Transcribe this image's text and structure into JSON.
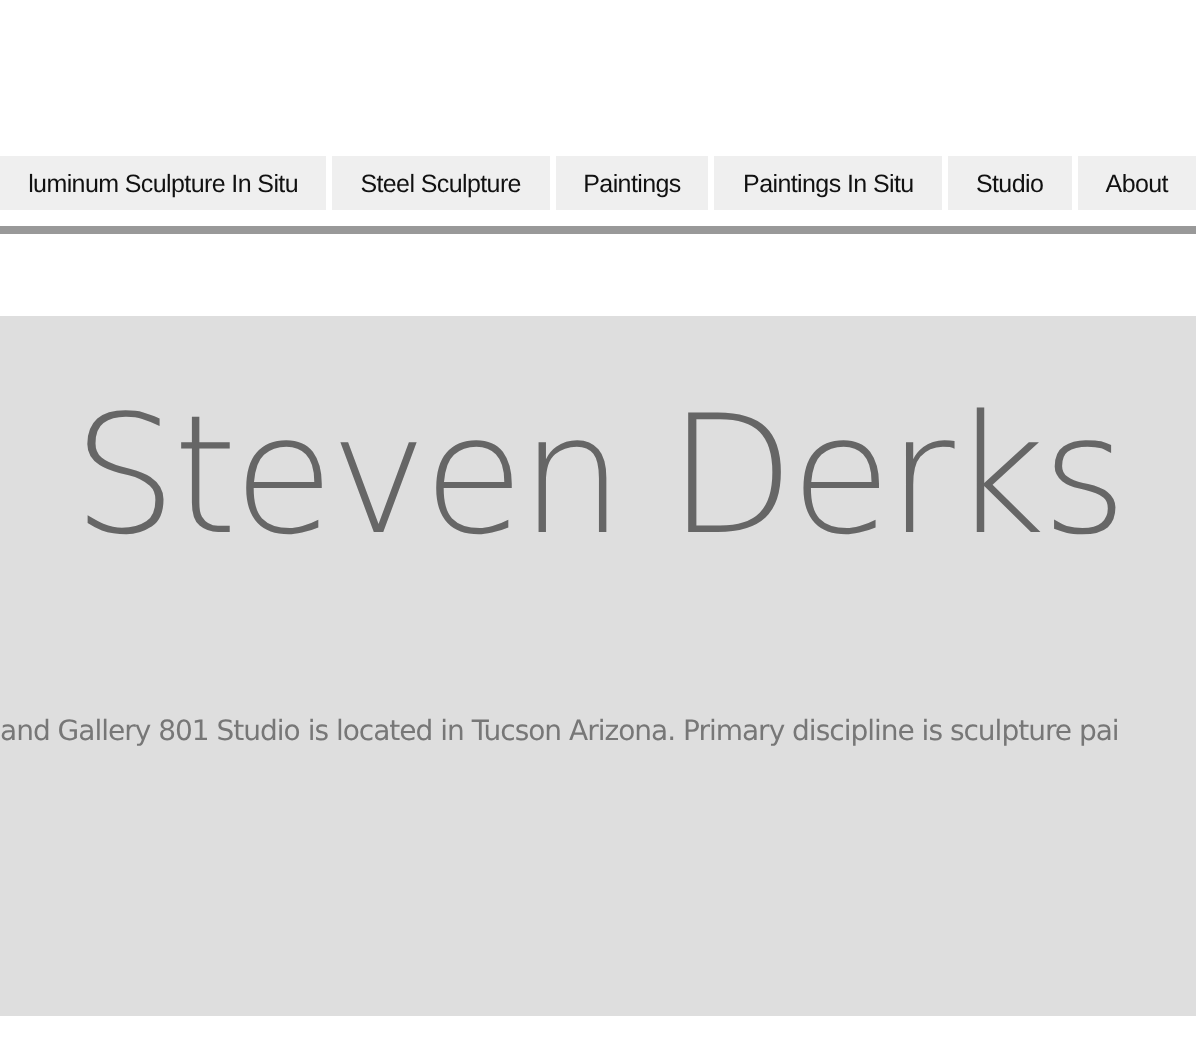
{
  "nav": {
    "items": [
      {
        "label": "luminum Sculpture In Situ"
      },
      {
        "label": "Steel Sculpture"
      },
      {
        "label": "Paintings"
      },
      {
        "label": "Paintings In Situ"
      },
      {
        "label": "Studio"
      },
      {
        "label": "About"
      }
    ]
  },
  "hero": {
    "title": "Steven Derks",
    "intro": "and Gallery 801 Studio is located in Tucson Arizona. Primary discipline is sculpture pai"
  }
}
